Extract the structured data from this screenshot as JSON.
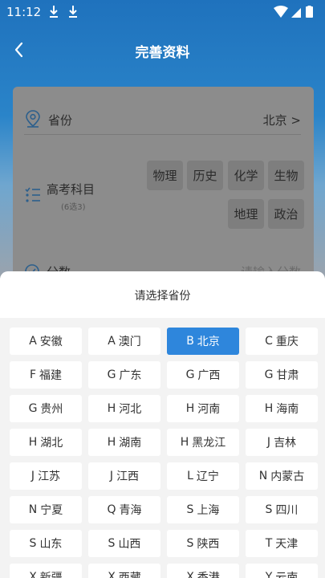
{
  "status_bar": {
    "time": "11:12",
    "icons": [
      "download-icon",
      "download-icon",
      "wifi-icon",
      "signal-icon",
      "battery-icon"
    ]
  },
  "header": {
    "title": "完善资料",
    "back_icon": "chevron-left-icon"
  },
  "form": {
    "province": {
      "label": "省份",
      "value": "北京 >",
      "icon": "location-pin-icon"
    },
    "subjects": {
      "label": "高考科目",
      "sublabel": "(6选3)",
      "icon": "list-icon",
      "options": [
        "物理",
        "历史",
        "化学",
        "生物",
        "地理",
        "政治"
      ]
    },
    "score": {
      "label": "分数",
      "placeholder": "请输入分数",
      "icon": "score-icon"
    }
  },
  "sheet": {
    "title": "请选择省份",
    "selected": "北京",
    "provinces": [
      {
        "letter": "A",
        "name": "安徽"
      },
      {
        "letter": "A",
        "name": "澳门"
      },
      {
        "letter": "B",
        "name": "北京"
      },
      {
        "letter": "C",
        "name": "重庆"
      },
      {
        "letter": "F",
        "name": "福建"
      },
      {
        "letter": "G",
        "name": "广东"
      },
      {
        "letter": "G",
        "name": "广西"
      },
      {
        "letter": "G",
        "name": "甘肃"
      },
      {
        "letter": "G",
        "name": "贵州"
      },
      {
        "letter": "H",
        "name": "河北"
      },
      {
        "letter": "H",
        "name": "河南"
      },
      {
        "letter": "H",
        "name": "海南"
      },
      {
        "letter": "H",
        "name": "湖北"
      },
      {
        "letter": "H",
        "name": "湖南"
      },
      {
        "letter": "H",
        "name": "黑龙江"
      },
      {
        "letter": "J",
        "name": "吉林"
      },
      {
        "letter": "J",
        "name": "江苏"
      },
      {
        "letter": "J",
        "name": "江西"
      },
      {
        "letter": "L",
        "name": "辽宁"
      },
      {
        "letter": "N",
        "name": "内蒙古"
      },
      {
        "letter": "N",
        "name": "宁夏"
      },
      {
        "letter": "Q",
        "name": "青海"
      },
      {
        "letter": "S",
        "name": "上海"
      },
      {
        "letter": "S",
        "name": "四川"
      },
      {
        "letter": "S",
        "name": "山东"
      },
      {
        "letter": "S",
        "name": "山西"
      },
      {
        "letter": "S",
        "name": "陕西"
      },
      {
        "letter": "T",
        "name": "天津"
      },
      {
        "letter": "X",
        "name": "新疆"
      },
      {
        "letter": "X",
        "name": "西藏"
      },
      {
        "letter": "X",
        "name": "香港"
      },
      {
        "letter": "Y",
        "name": "云南"
      }
    ]
  },
  "colors": {
    "accent": "#2e86dc",
    "header_blue": "#1f72bd",
    "sheet_bg": "#f3f3f3"
  }
}
